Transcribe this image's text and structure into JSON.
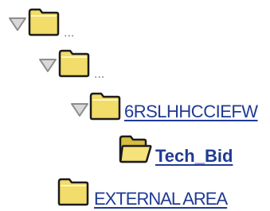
{
  "tree": {
    "nodes": [
      {
        "label": "...",
        "state": "expanded",
        "icon": "folder-closed-icon"
      },
      {
        "label": "...",
        "state": "expanded",
        "icon": "folder-closed-icon"
      },
      {
        "label": "6RSLHHCCIEFW",
        "state": "expanded",
        "icon": "folder-closed-icon"
      },
      {
        "label": "Tech_Bid",
        "state": "selected",
        "icon": "folder-open-icon"
      },
      {
        "label": "EXTERNAL AREA",
        "state": "leaf",
        "icon": "folder-closed-icon"
      }
    ]
  },
  "colors": {
    "link": "#1f3a93",
    "ellipsis": "#7a7a7a",
    "folder_fill": "#f2dc6a",
    "folder_stroke": "#1c1c1c",
    "toggle_fill": "#d8d8d8",
    "toggle_stroke": "#8c8c8c"
  }
}
